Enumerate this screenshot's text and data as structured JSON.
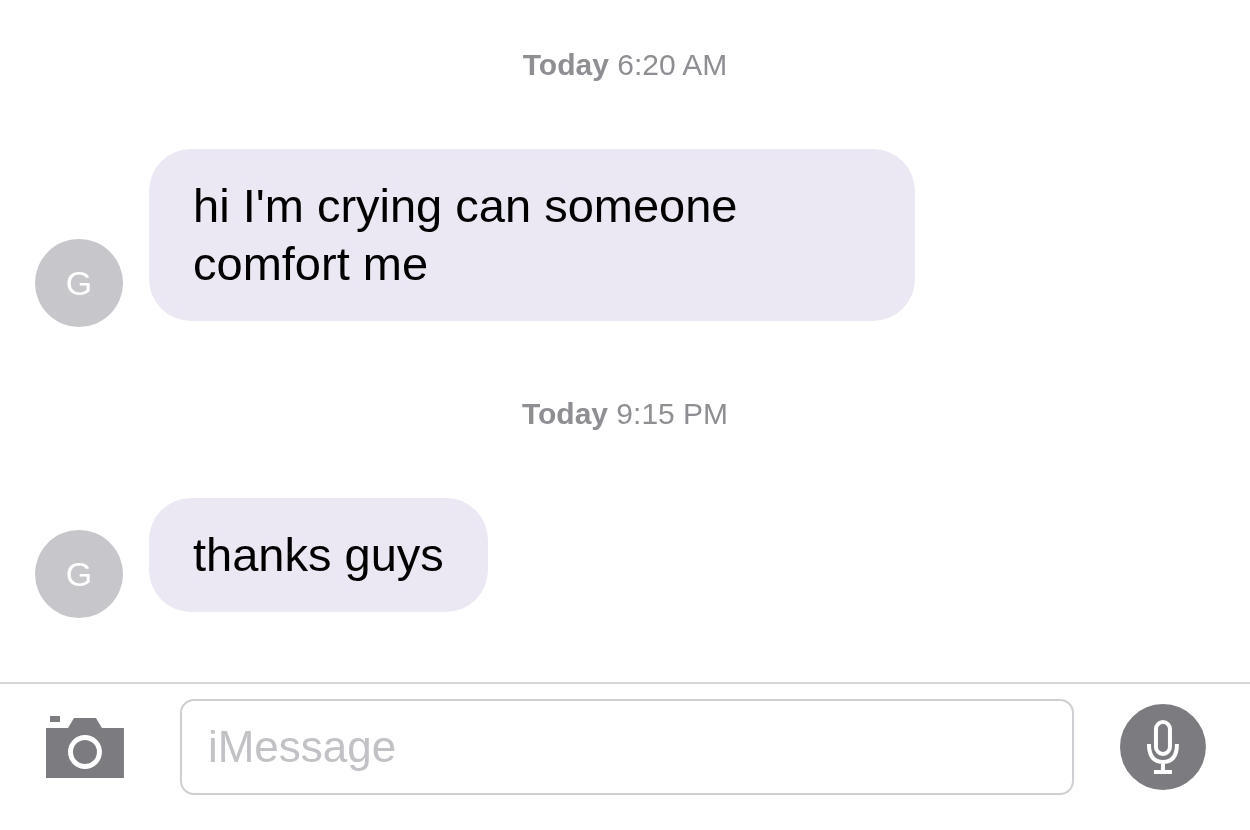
{
  "conversation": [
    {
      "kind": "timestamp",
      "text": "**Today** 6:20 AM"
    },
    {
      "kind": "message",
      "avatar_initial": "G",
      "lines": [
        "hi I'm crying can someone",
        "comfort me"
      ]
    },
    {
      "kind": "timestamp",
      "text": "**Today** 9:15 PM"
    },
    {
      "kind": "message",
      "avatar_initial": "G",
      "lines": [
        "thanks guys"
      ]
    }
  ],
  "compose": {
    "placeholder": "iMessage"
  }
}
